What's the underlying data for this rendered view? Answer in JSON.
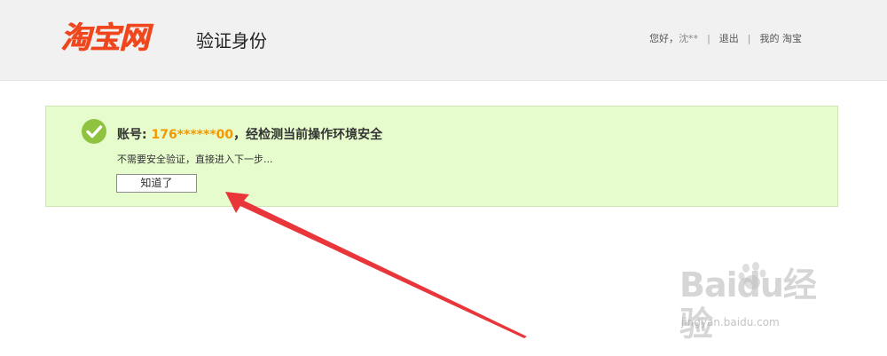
{
  "header": {
    "logo": "淘宝网",
    "title": "验证身份",
    "greeting": "您好，",
    "username": "沈**",
    "logout": "退出",
    "my_taobao": "我的 淘宝",
    "separator": "|"
  },
  "notice": {
    "title_prefix": "账号: ",
    "account": "176******00",
    "title_suffix": "，经检测当前操作环境安全",
    "subtitle": "不需要安全验证，直接进入下一步...",
    "button_label": "知道了"
  },
  "watermark": {
    "brand": "Baidu经验",
    "url": "jingyan.baidu.com"
  },
  "colors": {
    "accent": "#f0461e",
    "account": "#f39800",
    "notice_bg": "#e6fccd",
    "check": "#8fc33f",
    "arrow": "#e8363a"
  },
  "icons": {
    "check": "check-circle-icon",
    "arrow": "annotation-arrow"
  }
}
